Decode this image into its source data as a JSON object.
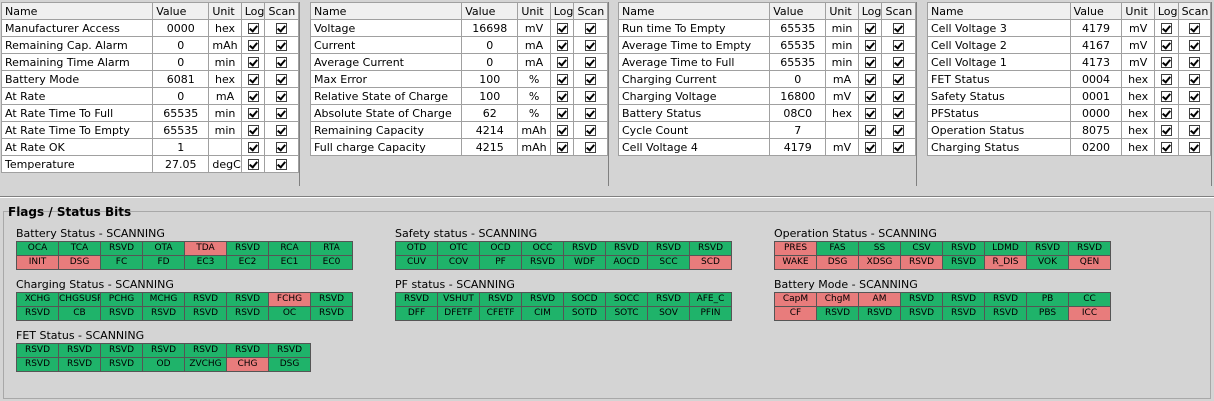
{
  "table_headers": {
    "name": "Name",
    "value": "Value",
    "unit": "Unit",
    "log": "Log",
    "scan": "Scan"
  },
  "tables": [
    {
      "rows": [
        {
          "name": "Manufacturer Access",
          "value": "0000",
          "unit": "hex",
          "log": true,
          "scan": true
        },
        {
          "name": "Remaining Cap. Alarm",
          "value": "0",
          "unit": "mAh",
          "log": true,
          "scan": true
        },
        {
          "name": "Remaining Time Alarm",
          "value": "0",
          "unit": "min",
          "log": true,
          "scan": true
        },
        {
          "name": "Battery Mode",
          "value": "6081",
          "unit": "hex",
          "log": true,
          "scan": true
        },
        {
          "name": "At Rate",
          "value": "0",
          "unit": "mA",
          "log": true,
          "scan": true
        },
        {
          "name": "At Rate Time To Full",
          "value": "65535",
          "unit": "min",
          "log": true,
          "scan": true
        },
        {
          "name": "At Rate Time To Empty",
          "value": "65535",
          "unit": "min",
          "log": true,
          "scan": true
        },
        {
          "name": "At Rate OK",
          "value": "1",
          "unit": "",
          "log": true,
          "scan": true
        },
        {
          "name": "Temperature",
          "value": "27.05",
          "unit": "degC",
          "log": true,
          "scan": true
        }
      ]
    },
    {
      "rows": [
        {
          "name": "Voltage",
          "value": "16698",
          "unit": "mV",
          "log": true,
          "scan": true
        },
        {
          "name": "Current",
          "value": "0",
          "unit": "mA",
          "log": true,
          "scan": true
        },
        {
          "name": "Average Current",
          "value": "0",
          "unit": "mA",
          "log": true,
          "scan": true
        },
        {
          "name": "Max Error",
          "value": "100",
          "unit": "%",
          "log": true,
          "scan": true
        },
        {
          "name": "Relative State of Charge",
          "value": "100",
          "unit": "%",
          "log": true,
          "scan": true
        },
        {
          "name": "Absolute State of Charge",
          "value": "62",
          "unit": "%",
          "log": true,
          "scan": true
        },
        {
          "name": "Remaining Capacity",
          "value": "4214",
          "unit": "mAh",
          "log": true,
          "scan": true
        },
        {
          "name": "Full charge Capacity",
          "value": "4215",
          "unit": "mAh",
          "log": true,
          "scan": true
        }
      ]
    },
    {
      "rows": [
        {
          "name": "Run time To Empty",
          "value": "65535",
          "unit": "min",
          "log": true,
          "scan": true
        },
        {
          "name": "Average Time to Empty",
          "value": "65535",
          "unit": "min",
          "log": true,
          "scan": true
        },
        {
          "name": "Average Time to Full",
          "value": "65535",
          "unit": "min",
          "log": true,
          "scan": true
        },
        {
          "name": "Charging Current",
          "value": "0",
          "unit": "mA",
          "log": true,
          "scan": true
        },
        {
          "name": "Charging Voltage",
          "value": "16800",
          "unit": "mV",
          "log": true,
          "scan": true
        },
        {
          "name": "Battery Status",
          "value": "08C0",
          "unit": "hex",
          "log": true,
          "scan": true
        },
        {
          "name": "Cycle Count",
          "value": "7",
          "unit": "",
          "log": true,
          "scan": true
        },
        {
          "name": "Cell Voltage 4",
          "value": "4179",
          "unit": "mV",
          "log": true,
          "scan": true
        }
      ]
    },
    {
      "rows": [
        {
          "name": "Cell Voltage 3",
          "value": "4179",
          "unit": "mV",
          "log": true,
          "scan": true
        },
        {
          "name": "Cell Voltage 2",
          "value": "4167",
          "unit": "mV",
          "log": true,
          "scan": true
        },
        {
          "name": "Cell Voltage 1",
          "value": "4173",
          "unit": "mV",
          "log": true,
          "scan": true
        },
        {
          "name": "FET Status",
          "value": "0004",
          "unit": "hex",
          "log": true,
          "scan": true
        },
        {
          "name": "Safety Status",
          "value": "0001",
          "unit": "hex",
          "log": true,
          "scan": true
        },
        {
          "name": "PFStatus",
          "value": "0000",
          "unit": "hex",
          "log": true,
          "scan": true
        },
        {
          "name": "Operation Status",
          "value": "8075",
          "unit": "hex",
          "log": true,
          "scan": true
        },
        {
          "name": "Charging Status",
          "value": "0200",
          "unit": "hex",
          "log": true,
          "scan": true
        }
      ]
    }
  ],
  "flags": {
    "title": "Flags / Status Bits",
    "colors": {
      "on": "#e87c7c",
      "off": "#1fb36a"
    },
    "groups": [
      {
        "title": "Battery Status - SCANNING",
        "bits": [
          [
            "OCA",
            0
          ],
          [
            "TCA",
            0
          ],
          [
            "RSVD",
            0
          ],
          [
            "OTA",
            0
          ],
          [
            "TDA",
            1
          ],
          [
            "RSVD",
            0
          ],
          [
            "RCA",
            0
          ],
          [
            "RTA",
            0
          ],
          [
            "INIT",
            1
          ],
          [
            "DSG",
            1
          ],
          [
            "FC",
            0
          ],
          [
            "FD",
            0
          ],
          [
            "EC3",
            0
          ],
          [
            "EC2",
            0
          ],
          [
            "EC1",
            0
          ],
          [
            "EC0",
            0
          ]
        ]
      },
      {
        "title": "Safety status - SCANNING",
        "bits": [
          [
            "OTD",
            0
          ],
          [
            "OTC",
            0
          ],
          [
            "OCD",
            0
          ],
          [
            "OCC",
            0
          ],
          [
            "RSVD",
            0
          ],
          [
            "RSVD",
            0
          ],
          [
            "RSVD",
            0
          ],
          [
            "RSVD",
            0
          ],
          [
            "CUV",
            0
          ],
          [
            "COV",
            0
          ],
          [
            "PF",
            0
          ],
          [
            "RSVD",
            0
          ],
          [
            "WDF",
            0
          ],
          [
            "AOCD",
            0
          ],
          [
            "SCC",
            0
          ],
          [
            "SCD",
            1
          ]
        ]
      },
      {
        "title": "Operation Status - SCANNING",
        "bits": [
          [
            "PRES",
            1
          ],
          [
            "FAS",
            0
          ],
          [
            "SS",
            0
          ],
          [
            "CSV",
            0
          ],
          [
            "RSVD",
            0
          ],
          [
            "LDMD",
            0
          ],
          [
            "RSVD",
            0
          ],
          [
            "RSVD",
            0
          ],
          [
            "WAKE",
            1
          ],
          [
            "DSG",
            1
          ],
          [
            "XDSG",
            1
          ],
          [
            "RSVD",
            1
          ],
          [
            "RSVD",
            0
          ],
          [
            "R_DIS",
            1
          ],
          [
            "VOK",
            0
          ],
          [
            "QEN",
            1
          ]
        ]
      },
      {
        "title": "Charging Status - SCANNING",
        "bits": [
          [
            "XCHG",
            0
          ],
          [
            "CHGSUSP",
            0
          ],
          [
            "PCHG",
            0
          ],
          [
            "MCHG",
            0
          ],
          [
            "RSVD",
            0
          ],
          [
            "RSVD",
            0
          ],
          [
            "FCHG",
            1
          ],
          [
            "RSVD",
            0
          ],
          [
            "RSVD",
            0
          ],
          [
            "CB",
            0
          ],
          [
            "RSVD",
            0
          ],
          [
            "RSVD",
            0
          ],
          [
            "RSVD",
            0
          ],
          [
            "RSVD",
            0
          ],
          [
            "OC",
            0
          ],
          [
            "RSVD",
            0
          ]
        ]
      },
      {
        "title": "PF status - SCANNING",
        "bits": [
          [
            "RSVD",
            0
          ],
          [
            "VSHUT",
            0
          ],
          [
            "RSVD",
            0
          ],
          [
            "RSVD",
            0
          ],
          [
            "SOCD",
            0
          ],
          [
            "SOCC",
            0
          ],
          [
            "RSVD",
            0
          ],
          [
            "AFE_C",
            0
          ],
          [
            "DFF",
            0
          ],
          [
            "DFETF",
            0
          ],
          [
            "CFETF",
            0
          ],
          [
            "CIM",
            0
          ],
          [
            "SOTD",
            0
          ],
          [
            "SOTC",
            0
          ],
          [
            "SOV",
            0
          ],
          [
            "PFIN",
            0
          ]
        ]
      },
      {
        "title": "Battery Mode - SCANNING",
        "bits": [
          [
            "CapM",
            1
          ],
          [
            "ChgM",
            1
          ],
          [
            "AM",
            1
          ],
          [
            "RSVD",
            0
          ],
          [
            "RSVD",
            0
          ],
          [
            "RSVD",
            0
          ],
          [
            "PB",
            0
          ],
          [
            "CC",
            0
          ],
          [
            "CF",
            1
          ],
          [
            "RSVD",
            0
          ],
          [
            "RSVD",
            0
          ],
          [
            "RSVD",
            0
          ],
          [
            "RSVD",
            0
          ],
          [
            "RSVD",
            0
          ],
          [
            "PBS",
            0
          ],
          [
            "ICC",
            1
          ]
        ]
      },
      {
        "title": "FET Status - SCANNING",
        "bits": [
          [
            "RSVD",
            0
          ],
          [
            "RSVD",
            0
          ],
          [
            "RSVD",
            0
          ],
          [
            "RSVD",
            0
          ],
          [
            "RSVD",
            0
          ],
          [
            "RSVD",
            0
          ],
          [
            "RSVD",
            0
          ],
          [
            "RSVD",
            0
          ],
          [
            "RSVD",
            0
          ],
          [
            "RSVD",
            0
          ],
          [
            "OD",
            0
          ],
          [
            "ZVCHG",
            0
          ],
          [
            "CHG",
            1
          ],
          [
            "DSG",
            0
          ]
        ]
      }
    ]
  }
}
